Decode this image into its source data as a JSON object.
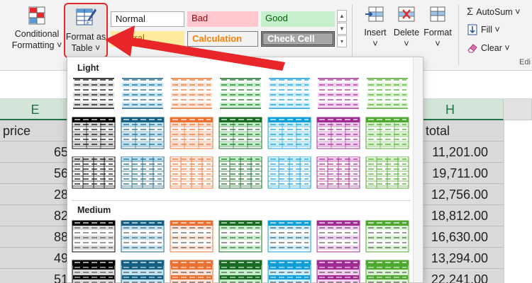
{
  "ribbon": {
    "conditional_formatting": {
      "line1": "Conditional",
      "line2": "Formatting ˅"
    },
    "format_as_table": {
      "line1": "Format as",
      "line2": "Table ˅"
    },
    "cell_styles": {
      "normal": "Normal",
      "bad": "Bad",
      "good": "Good",
      "neutral": "Neutral",
      "calculation": "Calculation",
      "check_cell": "Check Cell"
    },
    "cells": {
      "insert": "Insert",
      "delete": "Delete",
      "format": "Format",
      "chevron": "˅"
    },
    "editing": {
      "autosum": "AutoSum ˅",
      "fill": "Fill ˅",
      "clear": "Clear ˅",
      "group_label": "Edi"
    }
  },
  "grid": {
    "col_e": "E",
    "col_h": "H",
    "header_e": "price",
    "header_h": "total",
    "rows": [
      {
        "e": "65",
        "h": "11,201.00"
      },
      {
        "e": "56",
        "h": "19,711.00"
      },
      {
        "e": "28",
        "h": "12,756.00"
      },
      {
        "e": "82",
        "h": "18,812.00"
      },
      {
        "e": "88",
        "h": "16,630.00"
      },
      {
        "e": "49",
        "h": "13,294.00"
      },
      {
        "e": "51",
        "h": "22,241.00"
      }
    ]
  },
  "gallery": {
    "light_label": "Light",
    "medium_label": "Medium",
    "colors": [
      "#000000",
      "#156082",
      "#e97132",
      "#196b24",
      "#0f9ed5",
      "#a02b93",
      "#4ea72e"
    ],
    "tints": [
      "#d9d9d9",
      "#c0e4f5",
      "#fbe2d5",
      "#c1f0c8",
      "#caedfb",
      "#f2ceef",
      "#d9f2d0"
    ]
  },
  "accent_color": "#217346",
  "highlight_color": "#e8262a"
}
